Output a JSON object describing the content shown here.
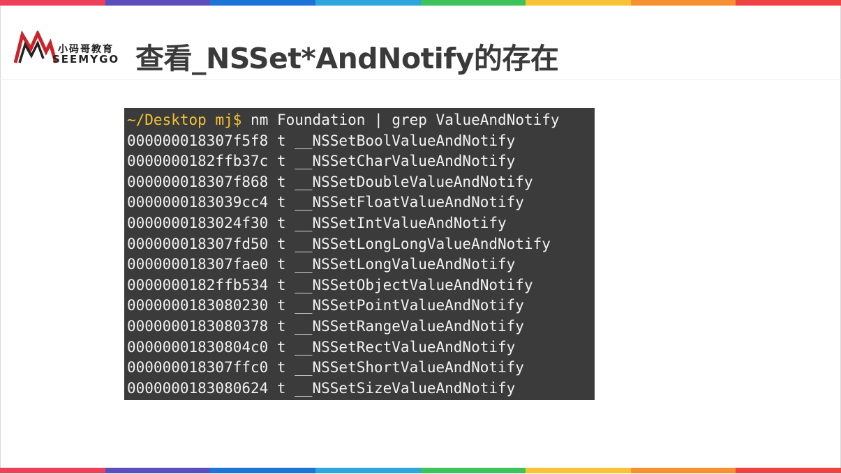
{
  "colors": {
    "stripe": [
      "#ee4056",
      "#5b4fbe",
      "#1c74d6",
      "#2ea6dd",
      "#3cc35b",
      "#f7c234",
      "#f7902e",
      "#ef4244"
    ],
    "terminal_bg": "#3b3b3b",
    "prompt": "#f3c332",
    "text": "#f2f2f2",
    "logo_red": "#c8242b"
  },
  "logo": {
    "cn": "小码哥教育",
    "en": "SEEMYGO",
    "icon": "mountain-m-logo-icon"
  },
  "title": "查看_NSSet*AndNotify的存在",
  "terminal": {
    "prompt_path": "~/Desktop",
    "prompt_user": "mj$",
    "command": "nm Foundation | grep ValueAndNotify",
    "lines": [
      "000000018307f5f8 t __NSSetBoolValueAndNotify",
      "0000000182ffb37c t __NSSetCharValueAndNotify",
      "000000018307f868 t __NSSetDoubleValueAndNotify",
      "0000000183039cc4 t __NSSetFloatValueAndNotify",
      "0000000183024f30 t __NSSetIntValueAndNotify",
      "000000018307fd50 t __NSSetLongLongValueAndNotify",
      "000000018307fae0 t __NSSetLongValueAndNotify",
      "0000000182ffb534 t __NSSetObjectValueAndNotify",
      "0000000183080230 t __NSSetPointValueAndNotify",
      "0000000183080378 t __NSSetRangeValueAndNotify",
      "00000001830804c0 t __NSSetRectValueAndNotify",
      "000000018307ffc0 t __NSSetShortValueAndNotify",
      "0000000183080624 t __NSSetSizeValueAndNotify"
    ]
  }
}
